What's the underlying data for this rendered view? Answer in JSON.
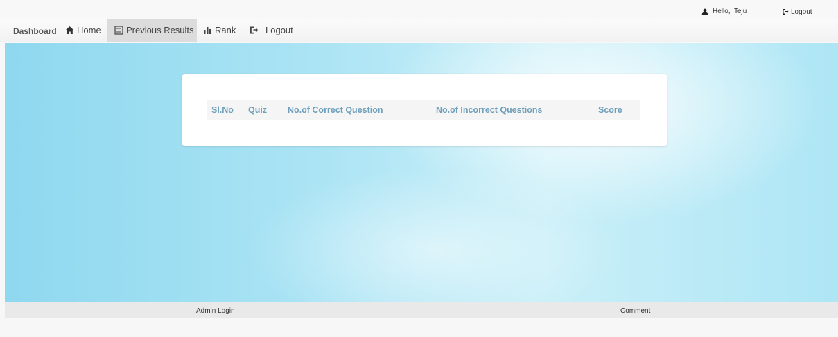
{
  "topbar": {
    "greeting": "Hello,  Teju",
    "logout_label": "Logout"
  },
  "navbar": {
    "brand": "Dashboard",
    "items": [
      {
        "label": "Home",
        "icon": "home-icon"
      },
      {
        "label": "Previous Results",
        "icon": "list-icon",
        "active": true
      },
      {
        "label": "Rank",
        "icon": "bar-chart-icon"
      },
      {
        "label": "Logout",
        "icon": "logout-icon"
      }
    ]
  },
  "results": {
    "columns": [
      "Sl.No",
      "Quiz",
      "No.of Correct Question",
      "No.of Incorrect Questions",
      "Score"
    ],
    "rows": []
  },
  "footer": {
    "admin_login": "Admin Login",
    "comment": "Comment"
  },
  "colors": {
    "header_text": "#6fa0bb",
    "hero_blue": "#a9e3f4",
    "active_nav": "#dcdcdc"
  }
}
